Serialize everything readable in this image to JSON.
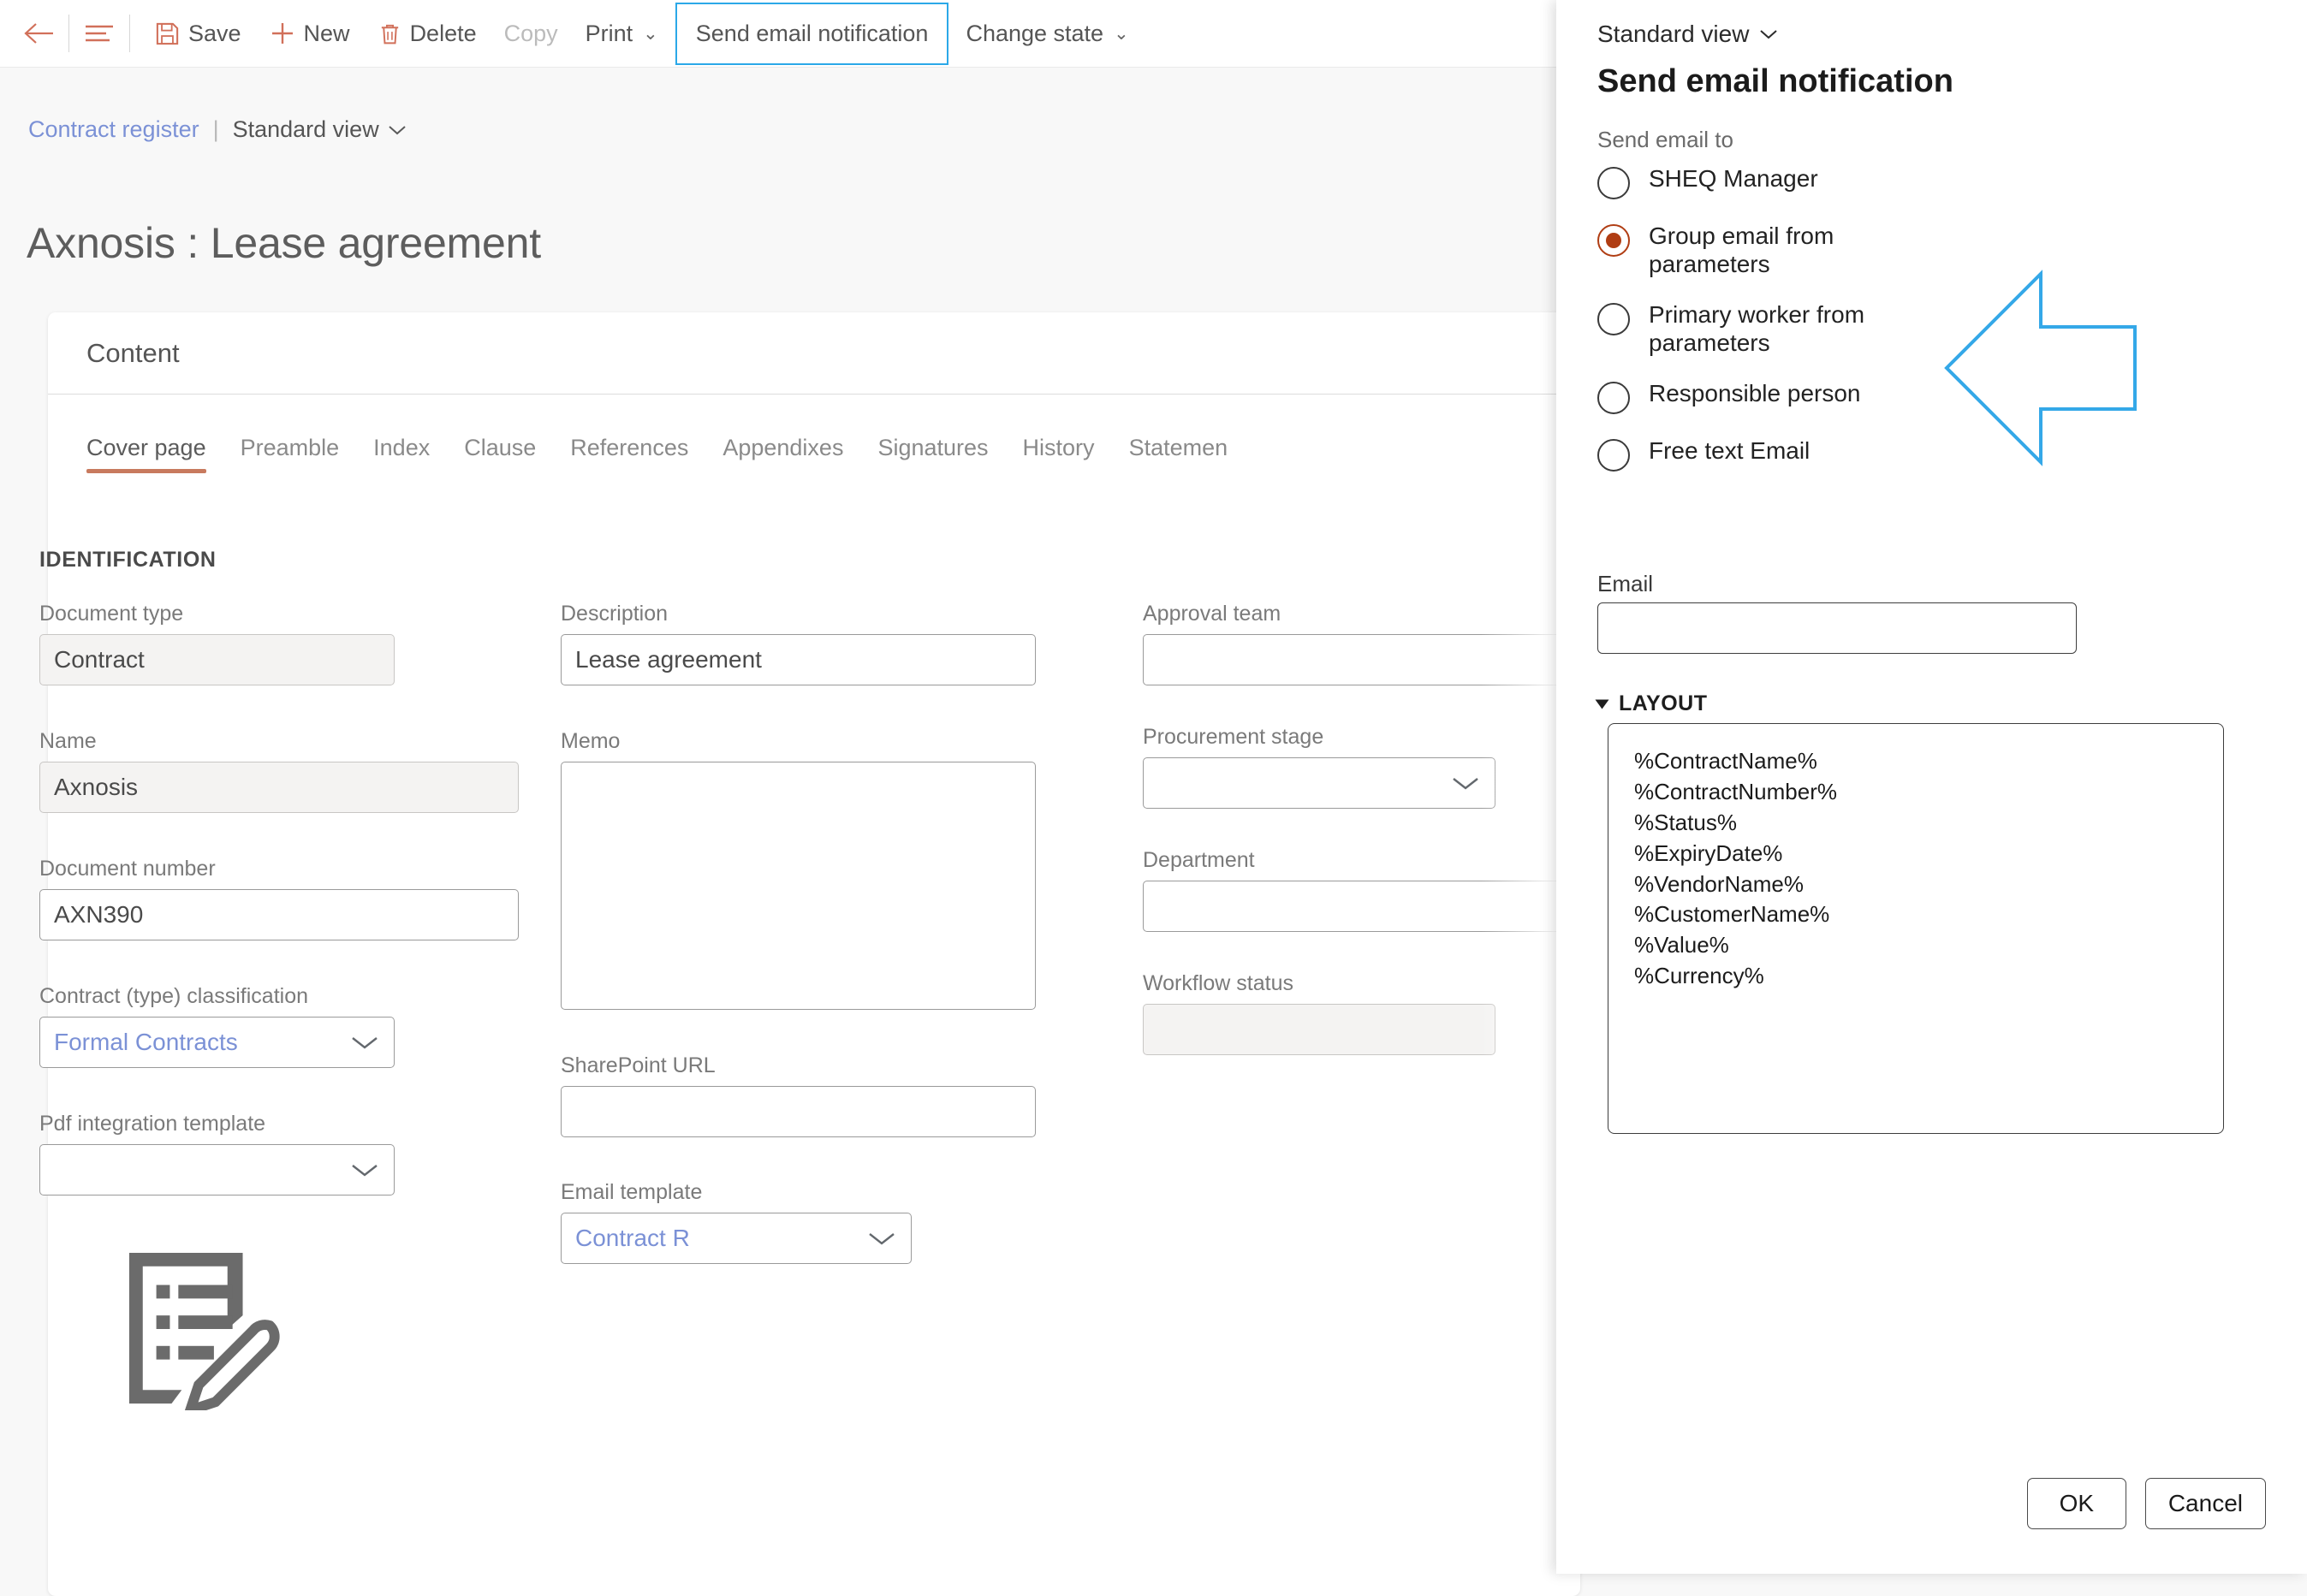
{
  "toolbar": {
    "back_icon": "arrow-left-icon",
    "menu_icon": "hamburger-menu-icon",
    "save_label": "Save",
    "save_icon": "floppy-disk-save-icon",
    "new_label": "New",
    "new_icon": "plus-icon",
    "delete_label": "Delete",
    "delete_icon": "trash-can-icon",
    "copy_label": "Copy",
    "print_label": "Print",
    "send_email_label": "Send email notification",
    "change_state_label": "Change state",
    "chevron": "⌄",
    "highlight_color": "#2ba8e8"
  },
  "breadcrumb": {
    "link": "Contract register",
    "separator": "|",
    "view": "Standard view",
    "chevron": "⌄"
  },
  "page": {
    "title": "Axnosis : Lease agreement"
  },
  "content_card": {
    "header": "Content",
    "tabs": [
      {
        "label": "Cover page",
        "active": true
      },
      {
        "label": "Preamble",
        "active": false
      },
      {
        "label": "Index",
        "active": false
      },
      {
        "label": "Clause",
        "active": false
      },
      {
        "label": "References",
        "active": false
      },
      {
        "label": "Appendixes",
        "active": false
      },
      {
        "label": "Signatures",
        "active": false
      },
      {
        "label": "History",
        "active": false
      },
      {
        "label": "Statemen",
        "active": false
      }
    ],
    "accent_color": "#c87a5e"
  },
  "form": {
    "section_title": "IDENTIFICATION",
    "document_type": {
      "label": "Document type",
      "value": "Contract",
      "readonly": true
    },
    "name": {
      "label": "Name",
      "value": "Axnosis",
      "readonly": true
    },
    "document_number": {
      "label": "Document number",
      "value": "AXN390",
      "readonly": false
    },
    "contract_classification": {
      "label": "Contract (type) classification",
      "value": "Formal Contracts",
      "readonly": false
    },
    "pdf_template": {
      "label": "Pdf integration template",
      "value": "",
      "readonly": false
    },
    "description": {
      "label": "Description",
      "value": "Lease agreement"
    },
    "memo": {
      "label": "Memo",
      "value": ""
    },
    "sharepoint_url": {
      "label": "SharePoint URL",
      "value": ""
    },
    "email_template": {
      "label": "Email template",
      "value": "Contract R"
    },
    "approval_team": {
      "label": "Approval team",
      "value": ""
    },
    "procurement_stage": {
      "label": "Procurement stage",
      "value": ""
    },
    "department": {
      "label": "Department",
      "value": ""
    },
    "workflow_status": {
      "label": "Workflow status",
      "value": "",
      "readonly": true
    },
    "doc_icon": "document-edit-icon"
  },
  "panel": {
    "view_selector": "Standard view",
    "chevron": "⌄",
    "title": "Send email notification",
    "send_email_to_label": "Send email to",
    "radio_options": [
      {
        "label": "SHEQ Manager",
        "selected": false
      },
      {
        "label": "Group email from parameters",
        "selected": true
      },
      {
        "label": "Primary worker from parameters",
        "selected": false
      },
      {
        "label": "Responsible person",
        "selected": false
      },
      {
        "label": "Free text Email",
        "selected": false
      }
    ],
    "selected_color": "#b03d13",
    "email": {
      "label": "Email",
      "value": ""
    },
    "layout_section": {
      "label": "LAYOUT",
      "expanded": true,
      "value": "%ContractName%\n%ContractNumber%\n%Status%\n%ExpiryDate%\n%VendorName%\n%CustomerName%\n%Value%\n%Currency%"
    },
    "ok_label": "OK",
    "cancel_label": "Cancel"
  },
  "annotation": {
    "arrow_icon": "left-pointing-arrow-annotation",
    "color": "#34a8e8"
  }
}
